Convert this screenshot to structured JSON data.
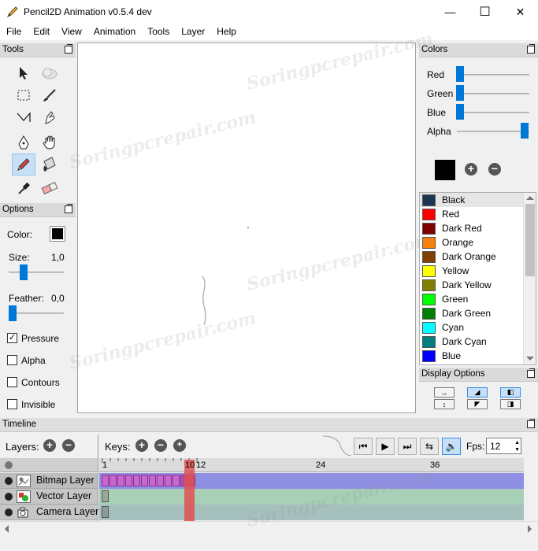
{
  "window": {
    "title": "Pencil2D Animation v0.5.4 dev",
    "minimize_glyph": "—",
    "maximize_glyph": "☐",
    "close_glyph": "✕"
  },
  "menu": [
    "File",
    "Edit",
    "View",
    "Animation",
    "Tools",
    "Layer",
    "Help"
  ],
  "tools_panel": {
    "title": "Tools",
    "tools": [
      {
        "name": "select-tool",
        "icon": "arrow-icon"
      },
      {
        "name": "smudge-tool",
        "icon": "cloud-icon"
      },
      {
        "name": "rectangle-select-tool",
        "icon": "dashed-rect-icon"
      },
      {
        "name": "brush-tool",
        "icon": "brush-icon"
      },
      {
        "name": "polyline-tool",
        "icon": "polyline-icon"
      },
      {
        "name": "smudge-hand-tool",
        "icon": "finger-icon"
      },
      {
        "name": "pen-tool",
        "icon": "pen-nib-icon"
      },
      {
        "name": "hand-tool",
        "icon": "hand-icon"
      },
      {
        "name": "pencil-tool",
        "icon": "pencil-icon",
        "active": true
      },
      {
        "name": "bucket-tool",
        "icon": "bucket-icon"
      },
      {
        "name": "eyedropper-tool",
        "icon": "eyedropper-icon"
      },
      {
        "name": "eraser-tool",
        "icon": "eraser-icon"
      }
    ]
  },
  "options_panel": {
    "title": "Options",
    "color_label": "Color:",
    "color_value": "#000000",
    "size_label": "Size:",
    "size_value": "1,0",
    "feather_label": "Feather:",
    "feather_value": "0,0",
    "pressure_label": "Pressure",
    "pressure_checked": true,
    "pressure_mark": "✓",
    "alpha_label": "Alpha",
    "contours_label": "Contours",
    "invisible_label": "Invisible"
  },
  "colors_panel": {
    "title": "Colors",
    "red_label": "Red",
    "green_label": "Green",
    "blue_label": "Blue",
    "alpha_label": "Alpha",
    "current_color": "#000000",
    "add_glyph": "+",
    "remove_glyph": "−",
    "swatches": [
      {
        "name": "Black",
        "color": "#1c3552",
        "selected": true
      },
      {
        "name": "Red",
        "color": "#ff0000"
      },
      {
        "name": "Dark Red",
        "color": "#800000"
      },
      {
        "name": "Orange",
        "color": "#ff8000"
      },
      {
        "name": "Dark Orange",
        "color": "#804000"
      },
      {
        "name": "Yellow",
        "color": "#ffff00"
      },
      {
        "name": "Dark Yellow",
        "color": "#808000"
      },
      {
        "name": "Green",
        "color": "#00ff00"
      },
      {
        "name": "Dark Green",
        "color": "#008000"
      },
      {
        "name": "Cyan",
        "color": "#00ffff"
      },
      {
        "name": "Dark Cyan",
        "color": "#008080"
      },
      {
        "name": "Blue",
        "color": "#0000ff"
      }
    ]
  },
  "display_panel": {
    "title": "Display Options"
  },
  "timeline": {
    "title": "Timeline",
    "layers_label": "Layers:",
    "keys_label": "Keys:",
    "fps_label": "Fps:",
    "fps_value": "12",
    "play_controls": {
      "to_start_glyph": "⏮",
      "play_glyph": "▶",
      "to_end_glyph": "⏭",
      "loop_glyph": "⇆",
      "sound_glyph": "🔈"
    },
    "ruler": [
      "1",
      "10",
      "12",
      "24",
      "36"
    ],
    "current_frame": 10,
    "layers": [
      {
        "name": "Bitmap Layer",
        "type": "bitmap",
        "selected": true
      },
      {
        "name": "Vector Layer",
        "type": "vector"
      },
      {
        "name": "Camera Layer",
        "type": "camera"
      }
    ]
  },
  "watermark": "Soringpcrepair.com",
  "colors": {
    "accent": "#0078d7",
    "bitmap_track": "#8f8fe3",
    "vector_track": "#a7d0b6",
    "camera_track": "#a6c0be",
    "playhead": "#e05050"
  }
}
